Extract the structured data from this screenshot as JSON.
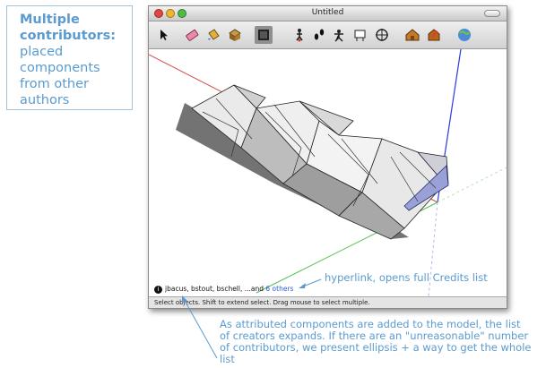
{
  "note": {
    "heading_line1": "Multiple",
    "heading_line2": "contributors:",
    "body_lines": [
      "placed",
      "components",
      "from other",
      "authors"
    ]
  },
  "window": {
    "title": "Untitled",
    "traffic_light_colors": [
      "#e3463e",
      "#f0b62c",
      "#4cbd46"
    ],
    "toolbar_icons": [
      "select-arrow-icon",
      "eraser-icon",
      "paint-bucket-icon",
      "component-icon",
      "section-box-icon",
      "person-walk-icon",
      "footprints-icon",
      "look-around-icon",
      "position-camera-icon",
      "orbit-icon",
      "house-warehouse-icon",
      "share-model-icon",
      "google-earth-icon"
    ],
    "selected_tool_index": 4,
    "status_text": "Select objects. Shift to extend select. Drag mouse to select multiple."
  },
  "credits": {
    "names": "jbacus, bstout, bschell, ...and",
    "link_text": "6 others"
  },
  "callouts": {
    "hyperlink_note": "hyperlink, opens full Credits list",
    "explanation": "As attributed components are added to the model, the list of creators expands. If there are an \"unreasonable\" number of contributors, we present ellipsis + a way to get the whole list"
  },
  "colors": {
    "annotation_blue": "#5b9bd0",
    "link_blue": "#2a5bd8",
    "axis_red": "#d44b4b",
    "axis_green": "#4cc24c",
    "axis_blue": "#2b3bdc"
  }
}
